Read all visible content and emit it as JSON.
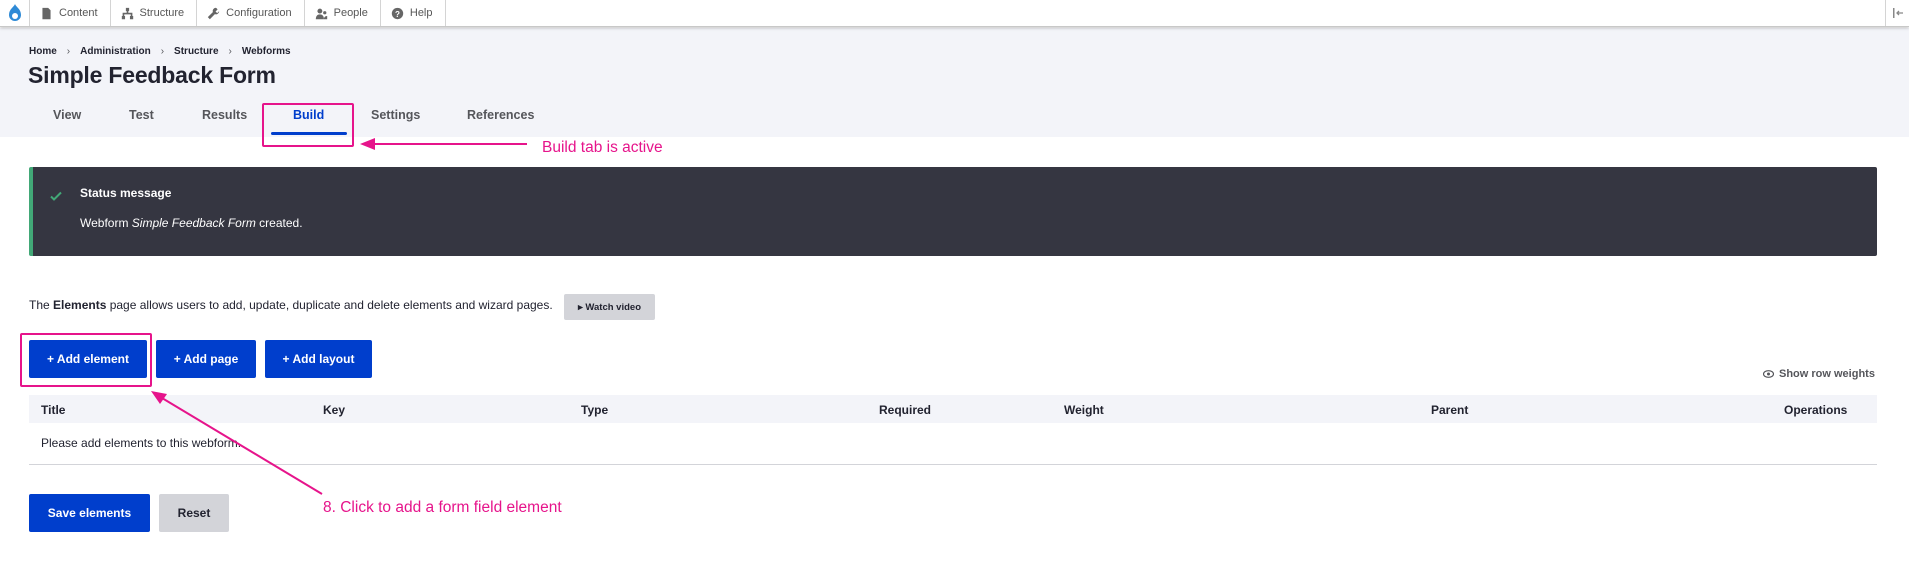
{
  "toolbar": {
    "items": [
      {
        "label": "Content",
        "icon": "document-icon"
      },
      {
        "label": "Structure",
        "icon": "sitemap-icon"
      },
      {
        "label": "Configuration",
        "icon": "wrench-icon"
      },
      {
        "label": "People",
        "icon": "people-icon"
      },
      {
        "label": "Help",
        "icon": "help-icon"
      }
    ]
  },
  "breadcrumb": [
    "Home",
    "Administration",
    "Structure",
    "Webforms"
  ],
  "page_title": "Simple Feedback Form",
  "tabs": [
    "View",
    "Test",
    "Results",
    "Build",
    "Settings",
    "References"
  ],
  "active_tab": "Build",
  "annotations": {
    "build_tab": "Build tab is active",
    "add_element": "8. Click to add a form field element"
  },
  "status": {
    "title": "Status message",
    "body_prefix": "Webform ",
    "body_em": "Simple Feedback Form",
    "body_suffix": " created."
  },
  "description": {
    "prefix": "The ",
    "strong": "Elements",
    "suffix": " page allows users to add, update, duplicate and delete elements and wizard pages."
  },
  "watch_video": "▸ Watch video",
  "buttons": {
    "add_element": "+ Add element",
    "add_page": "+ Add page",
    "add_layout": "+ Add layout",
    "save": "Save elements",
    "reset": "Reset"
  },
  "show_row_weights": "Show row weights",
  "table": {
    "columns": [
      "Title",
      "Key",
      "Type",
      "Required",
      "Weight",
      "Parent",
      "Operations"
    ],
    "empty_text": "Please add elements to this webform."
  },
  "colors": {
    "primary": "#003ecc",
    "annotation": "#e6148b",
    "status_bg": "#353641",
    "status_accent": "#42a877"
  }
}
